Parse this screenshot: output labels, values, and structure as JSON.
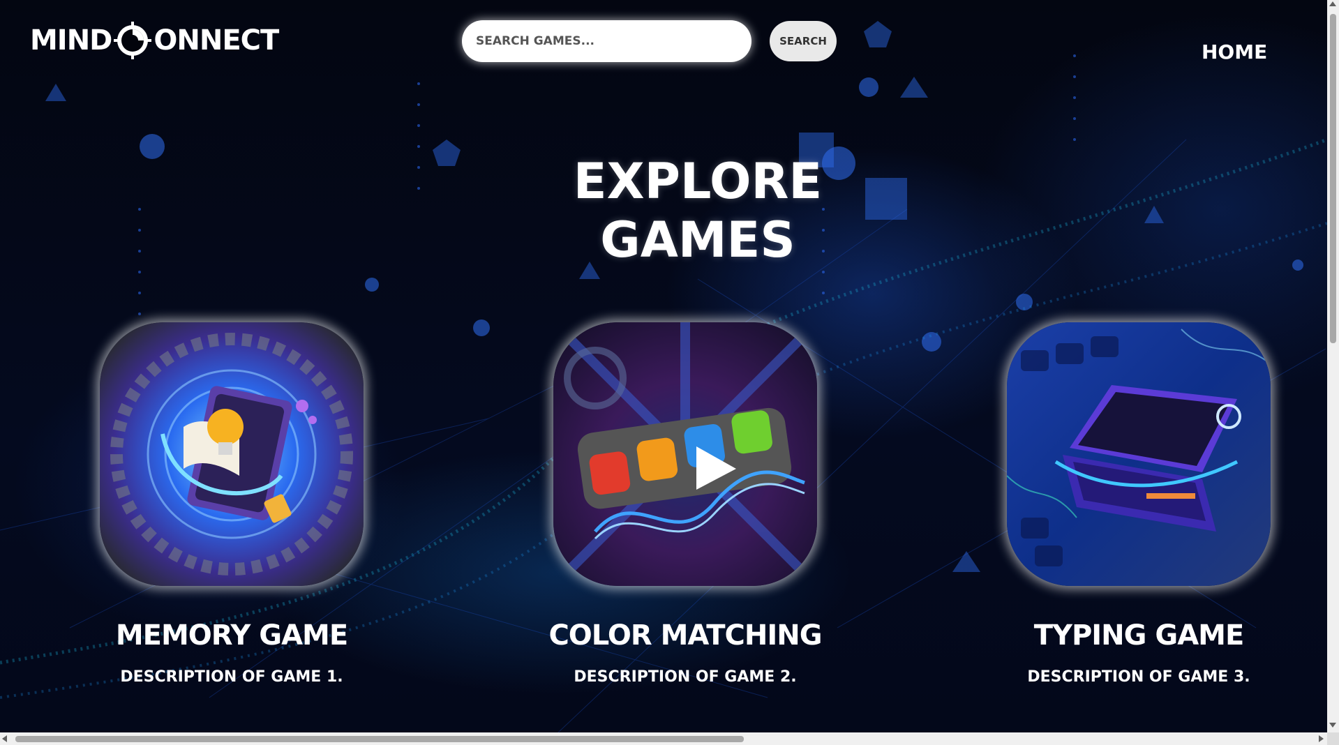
{
  "header": {
    "logo_text_left": "MIND",
    "logo_text_right": "ONNECT",
    "search_placeholder": "SEARCH GAMES...",
    "search_button": "SEARCH",
    "nav_home": "HOME"
  },
  "main": {
    "title": "EXPLORE GAMES"
  },
  "games": [
    {
      "title": "MEMORY GAME",
      "description": "DESCRIPTION OF GAME 1.",
      "icon": "lightbulb-book-icon"
    },
    {
      "title": "COLOR MATCHING",
      "description": "DESCRIPTION OF GAME 2.",
      "icon": "color-blocks-play-icon"
    },
    {
      "title": "TYPING GAME",
      "description": "DESCRIPTION OF GAME 3.",
      "icon": "laptop-icon"
    }
  ],
  "colors": {
    "background": "#02040c",
    "accent_blue": "#1e5adc",
    "text": "#ffffff"
  }
}
